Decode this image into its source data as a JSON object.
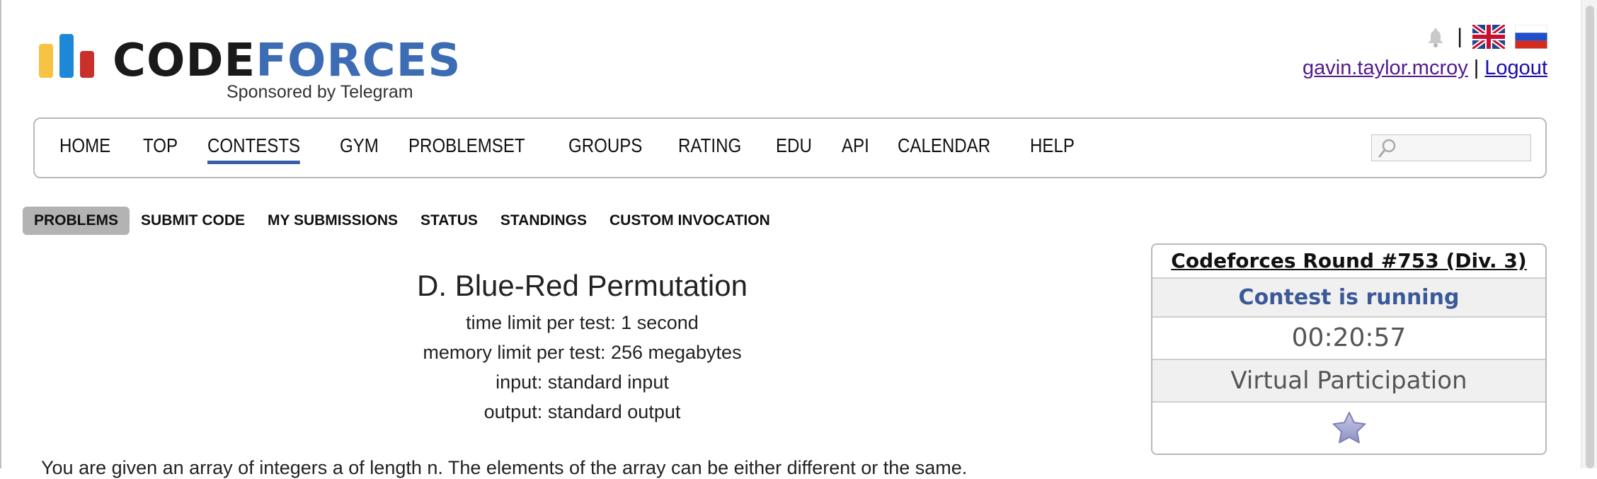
{
  "logo": {
    "code": "CODE",
    "forces": "FORCES",
    "sponsor": "Sponsored by Telegram"
  },
  "header": {
    "username": "gavin.taylor.mcroy",
    "separator": "|",
    "logout": "Logout",
    "top_separator": "|"
  },
  "main_menu": {
    "items": [
      "HOME",
      "TOP",
      "CONTESTS",
      "GYM",
      "PROBLEMSET",
      "GROUPS",
      "RATING",
      "EDU",
      "API",
      "CALENDAR",
      "HELP"
    ],
    "active": "CONTESTS",
    "search_placeholder": ""
  },
  "second_menu": {
    "items": [
      "PROBLEMS",
      "SUBMIT CODE",
      "MY SUBMISSIONS",
      "STATUS",
      "STANDINGS",
      "CUSTOM INVOCATION"
    ],
    "active": "PROBLEMS"
  },
  "problem": {
    "title": "D. Blue-Red Permutation",
    "time_limit": "time limit per test: 1 second",
    "memory_limit": "memory limit per test: 256 megabytes",
    "input": "input: standard input",
    "output": "output: standard output",
    "statement_start": "You are given an array of integers a of length n. The elements of the array can be either different or the same."
  },
  "sidebar": {
    "contest_name": "Codeforces Round #753 (Div. 3)",
    "status": "Contest is running",
    "timer": "00:20:57",
    "participation": "Virtual Participation"
  },
  "colors": {
    "accent": "#3b5fa4",
    "status_text": "#3b5998",
    "logo_forces": "#3b6cb4"
  },
  "icons": [
    "bell-icon",
    "uk-flag-icon",
    "ru-flag-icon",
    "search-icon",
    "star-icon"
  ]
}
